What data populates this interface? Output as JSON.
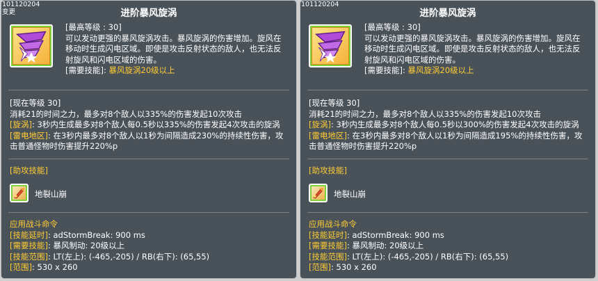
{
  "panels": [
    {
      "skill_id": "101120204",
      "changed_tag": "变更",
      "title": "进阶暴风旋涡",
      "desc": {
        "max_level": "[最高等级 : 30]",
        "lines": [
          "可以发动更强的暴风旋涡攻击。暴风旋涡的伤害增加。旋风在",
          "移动时生成闪电区域。即使是攻击反射状态的敌人，也无法反",
          "射旋风和闪电区域的伤害。"
        ],
        "required_label": "[需要技能]: ",
        "required_value": "暴风旋涡20级以上"
      },
      "current": {
        "level": "[现在等级 30]",
        "line1": "消耗21的时间之力，最多对8个敌人以335%的伤害发起10次攻击",
        "vortex_tag": "[旋涡]",
        "vortex_text": ": 3秒内生成最多对8个敌人每0.5秒以335%的伤害发起4次攻击的旋涡",
        "lightning_tag": "[雷电地区]",
        "lightning_text": ": 在3秒内最多对8个敌人以1秒为间隔造成230%的持续性伤害，攻",
        "lightning_text2": "击普通怪物时伤害提升220%p"
      },
      "assist": {
        "header": "[助攻技能]",
        "skill_name": "地裂山崩"
      },
      "command": {
        "header": "应用战斗命令",
        "delay_tag": "[技能延时]",
        "delay_text": ": adStormBreak: 900 ms",
        "req_tag": "[需要技能]",
        "req_text": ": 暴风制动: 20级以上",
        "range_tag": "[技能范围]",
        "range_text": ": LT(左上): (-465,-205) / RB(右下): (65,55)",
        "area_tag": "[范围]",
        "area_text": ": 530 x 260"
      }
    },
    {
      "skill_id": "101120204",
      "changed_tag": "",
      "title": "进阶暴风旋涡",
      "desc": {
        "max_level": "[最高等级 : 30]",
        "lines": [
          "可以发动更强的暴风旋涡攻击。暴风旋涡的伤害增加。旋风在",
          "移动时生成闪电区域。即使是攻击反射状态的敌人，也无法反",
          "射旋风和闪电区域的伤害。"
        ],
        "required_label": "[需要技能]: ",
        "required_value": "暴风旋涡20级以上"
      },
      "current": {
        "level": "[现在等级 30]",
        "line1": "消耗21的时间之力，最多对8个敌人以335%的伤害发起10次攻击",
        "vortex_tag": "[旋涡]",
        "vortex_text": ": 3秒内生成最多对8个敌人每0.5秒以300%的伤害发起4次攻击的旋涡",
        "lightning_tag": "[雷电地区]",
        "lightning_text": ": 在3秒内最多对8个敌人以1秒为间隔造成195%的持续性伤害，攻",
        "lightning_text2": "击普通怪物时伤害提升220%p"
      },
      "assist": {
        "header": "[助攻技能]",
        "skill_name": "地裂山崩"
      },
      "command": {
        "header": "应用战斗命令",
        "delay_tag": "[技能延时]",
        "delay_text": ": adStormBreak: 900 ms",
        "req_tag": "[需要技能]",
        "req_text": ": 暴风制动: 20级以上",
        "range_tag": "[技能范围]",
        "range_text": ": LT(左上): (-465,-205) / RB(右下): (65,55)",
        "area_tag": "[范围]",
        "area_text": ": 530 x 260"
      }
    }
  ],
  "colors": {
    "panel_bg": "#4a5259",
    "highlight": "#ffcc33",
    "text": "#ffffff",
    "icon_border": "#7dd23b"
  },
  "icons": {
    "skill_icon": "storm-vortex-skill-icon",
    "assist_icon": "earth-split-skill-icon"
  }
}
